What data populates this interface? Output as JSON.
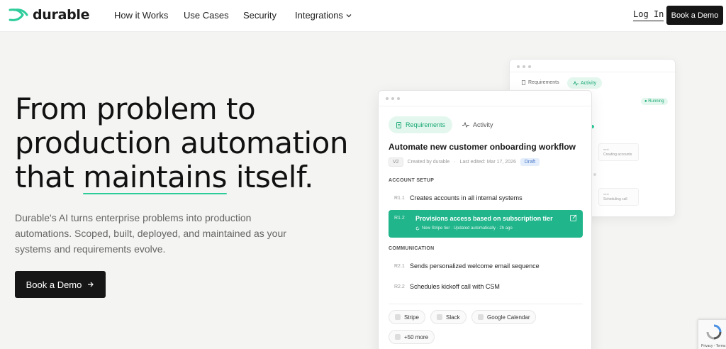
{
  "brand": {
    "name": "durable",
    "accent": "#2ecc9a"
  },
  "nav": {
    "links": [
      "How it Works",
      "Use Cases",
      "Security",
      "Integrations"
    ],
    "login": "Log In",
    "demo": "Book a Demo"
  },
  "hero": {
    "title_line1": "From problem to",
    "title_line2": "production automation",
    "title_line3_word": "maintains",
    "title_line3_pre": "that ",
    "title_line3_post": " itself.",
    "subtitle": "Durable's AI turns enterprise problems into production automations. Scoped, built, deployed, and maintained as your systems and requirements evolve.",
    "button": "Book a Demo"
  },
  "back_card": {
    "tab_requirements": "Requirements",
    "tab_activity": "Activity",
    "running": "● Running",
    "box1_small": "next",
    "box1_text": "Creating accounts",
    "box2_small": "next",
    "box2_text": "Scheduling call"
  },
  "front_card": {
    "tab_requirements": "Requirements",
    "tab_activity": "Activity",
    "title": "Automate new customer onboarding workflow",
    "version": "V2",
    "created_by": "Created by durable",
    "last_edited": "Last edited: Mar 17, 2026",
    "status": "Draft",
    "section1": "ACCOUNT SETUP",
    "section2": "COMMUNICATION",
    "items": [
      {
        "id": "R1.1",
        "label": "Creates accounts in all internal systems"
      },
      {
        "id": "R1.2",
        "label": "Provisions access based on subscription tier",
        "sub": "New Stripe tier · Updated automatically · 2h ago"
      },
      {
        "id": "R2.1",
        "label": "Sends personalized welcome email sequence"
      },
      {
        "id": "R2.2",
        "label": "Schedules kickoff call with CSM"
      }
    ],
    "integrations": [
      "Stripe",
      "Slack",
      "Google Calendar",
      "+50 more"
    ]
  },
  "recaptcha": {
    "text": "Privacy - Terms"
  }
}
